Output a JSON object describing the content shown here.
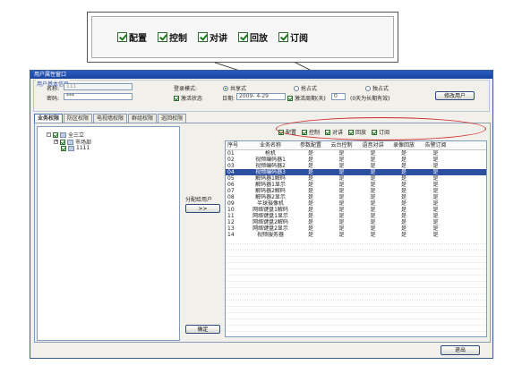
{
  "callout": {
    "items": [
      "配置",
      "控制",
      "对讲",
      "回放",
      "订阅"
    ]
  },
  "window": {
    "title": "用户属性窗口",
    "group_title": "用户基本信息",
    "name_label": "名称:",
    "name_value": "111",
    "password_label": "密码:",
    "password_value": "***",
    "login_mode_label": "登录模式:",
    "login_modes": [
      "共享式",
      "抢占式",
      "独占式"
    ],
    "activate_label": "激活状态",
    "date_label": "日期:",
    "date_value": "2009- 4-29",
    "activate_period_label": "激活周期(天)",
    "activate_period_value": "0",
    "permanent_note": "(0天为长期有效)",
    "modify_button": "修改用户",
    "tabs": [
      "业务权限",
      "防区权限",
      "电视墙权限",
      "群组权限",
      "巡回权限"
    ],
    "tree": [
      {
        "label": "全三立",
        "level": 0
      },
      {
        "label": "市场部",
        "level": 1
      },
      {
        "label": "1111",
        "level": 2
      }
    ],
    "assign_label": "分配给用户",
    "assign_button": ">>",
    "confirm_button": "确定",
    "exit_button": "退出",
    "perms": [
      "配置",
      "控制",
      "对讲",
      "回放",
      "订阅"
    ]
  },
  "grid": {
    "columns": [
      "序号",
      "业务名称",
      "参数配置",
      "云台控制",
      "语音对讲",
      "录像回放",
      "告警订阅"
    ],
    "rows": [
      [
        "01",
        "枪机",
        "是",
        "是",
        "是",
        "是",
        "是"
      ],
      [
        "02",
        "视频编码器1",
        "是",
        "是",
        "是",
        "是",
        "是"
      ],
      [
        "03",
        "视频编码器2",
        "是",
        "是",
        "是",
        "是",
        "是"
      ],
      [
        "04",
        "视频编码器3",
        "是",
        "是",
        "是",
        "是",
        "是"
      ],
      [
        "05",
        "解码器1解码",
        "是",
        "是",
        "是",
        "是",
        "是"
      ],
      [
        "06",
        "解码器1显示",
        "是",
        "是",
        "是",
        "是",
        "是"
      ],
      [
        "07",
        "解码器2解码",
        "是",
        "是",
        "是",
        "是",
        "是"
      ],
      [
        "08",
        "解码器2显示",
        "是",
        "是",
        "是",
        "是",
        "是"
      ],
      [
        "09",
        "半球摄像机",
        "是",
        "是",
        "是",
        "是",
        "是"
      ],
      [
        "10",
        "网络键盘1解码",
        "是",
        "是",
        "是",
        "是",
        "是"
      ],
      [
        "11",
        "网络键盘1显示",
        "是",
        "是",
        "是",
        "是",
        "是"
      ],
      [
        "12",
        "网络键盘2解码",
        "是",
        "是",
        "是",
        "是",
        "是"
      ],
      [
        "13",
        "网络键盘2显示",
        "是",
        "是",
        "是",
        "是",
        "是"
      ],
      [
        "14",
        "视频服务器",
        "是",
        "是",
        "是",
        "是",
        "是"
      ]
    ],
    "selected_row": 3,
    "empty_rows": 16
  }
}
